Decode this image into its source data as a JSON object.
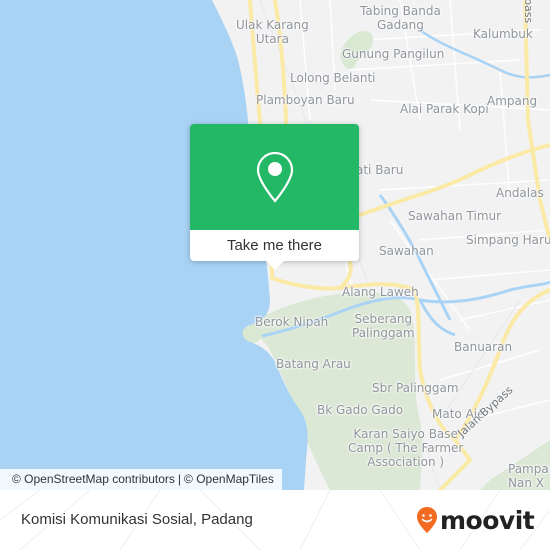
{
  "map": {
    "colors": {
      "water": "#a9d3f5",
      "land": "#f2f2f3",
      "park": "#d8e8d2",
      "major_road": "#fbe9a6",
      "river": "#a9d3f5"
    },
    "places": [
      {
        "label": "Tabing Banda\nGadang"
      },
      {
        "label": "Ulak Karang\nUtara"
      },
      {
        "label": "Kalumbuk"
      },
      {
        "label": "Gunung Pangilun"
      },
      {
        "label": "Lolong Belanti"
      },
      {
        "label": "Plamboyan Baru"
      },
      {
        "label": "Alai Parak Kopi"
      },
      {
        "label": "Ampang"
      },
      {
        "label": "ati Baru"
      },
      {
        "label": "Andalas"
      },
      {
        "label": "Sawahan Timur"
      },
      {
        "label": "Simpang Haru"
      },
      {
        "label": "Sawahan"
      },
      {
        "label": "Alang Laweh"
      },
      {
        "label": "Berok Nipah"
      },
      {
        "label": "Seberang\nPalinggam"
      },
      {
        "label": "Batang Arau"
      },
      {
        "label": "Banuaran"
      },
      {
        "label": "Sbr Palinggam"
      },
      {
        "label": "Bk Gado Gado"
      },
      {
        "label": "Mato Aie"
      },
      {
        "label": "Karan Saiyo Base\nCamp ( The Farmer\nAssociation )"
      },
      {
        "label": "Pampar\nNan X"
      }
    ],
    "road_labels": [
      {
        "label": "Jalan Bypass"
      },
      {
        "label": "pass"
      }
    ],
    "attribution": {
      "osm": "© OpenStreetMap contributors",
      "separator": "|",
      "omt": "© OpenMapTiles"
    }
  },
  "popup": {
    "icon": "map-pin-icon",
    "cta_label": "Take me there",
    "color": "#22b865"
  },
  "footer": {
    "title": "Komisi Komunikasi Sosial, Padang",
    "brand": "moovit",
    "brand_color": "#f26b21"
  }
}
